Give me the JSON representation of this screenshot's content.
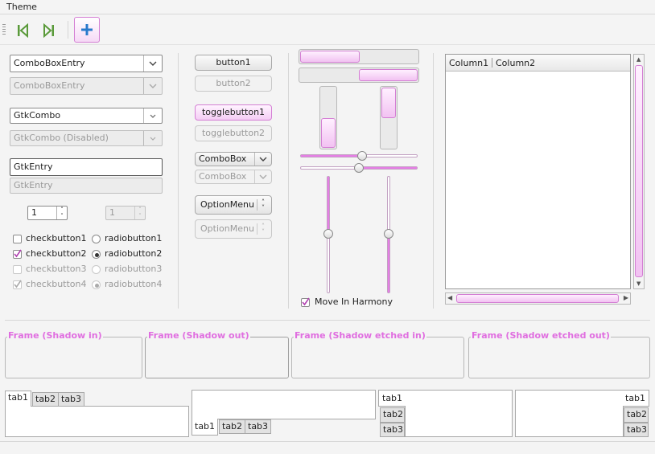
{
  "menubar": {
    "theme_label": "Theme"
  },
  "colors": {
    "accent": "#e06ee0",
    "accent_fill": "#f4ccf4"
  },
  "col1": {
    "comboboxentry1": "ComboBoxEntry",
    "comboboxentry2": "ComboBoxEntry",
    "gtkcombo1": "GtkCombo",
    "gtkcombo2": "GtkCombo (Disabled)",
    "gtkentry1": "GtkEntry",
    "gtkentry2": "GtkEntry",
    "spin1": "1",
    "spin2": "1",
    "checks": [
      "checkbutton1",
      "checkbutton2",
      "checkbutton3",
      "checkbutton4"
    ],
    "radios": [
      "radiobutton1",
      "radiobutton2",
      "radiobutton3",
      "radiobutton4"
    ]
  },
  "col2": {
    "button1": "button1",
    "button2": "button2",
    "toggle1": "togglebutton1",
    "toggle2": "togglebutton2",
    "combobox1": "ComboBox",
    "combobox2": "ComboBox",
    "optionmenu1": "OptionMenu",
    "optionmenu2": "OptionMenu"
  },
  "col3": {
    "progress": {
      "h1": 0.5,
      "h2": 0.5,
      "v1": 0.5,
      "v2": 0.5
    },
    "move_in_harmony": "Move In Harmony"
  },
  "tree": {
    "column1": "Column1",
    "column2": "Column2"
  },
  "frames": [
    "Frame (Shadow in)",
    "Frame (Shadow out)",
    "Frame (Shadow etched in)",
    "Frame (Shadow etched out)"
  ],
  "tabs": {
    "tab1": "tab1",
    "tab2": "tab2",
    "tab3": "tab3"
  }
}
